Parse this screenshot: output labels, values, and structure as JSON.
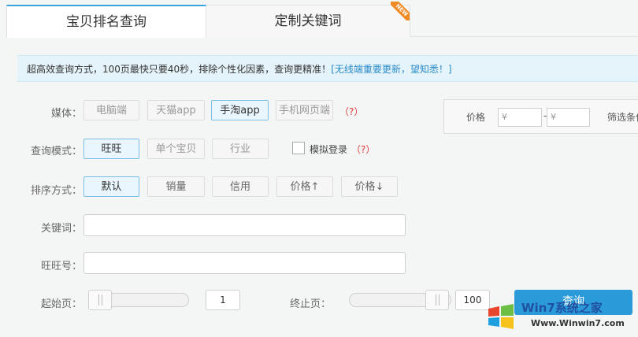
{
  "tabs": {
    "active": "宝贝排名查询",
    "inactive": "定制关键词",
    "badge": "NEW"
  },
  "notice": {
    "text": "超高效查询方式，100页最快只要40秒，排除个性化因素，查询更精准！",
    "link": "[无线端重要更新，望知悉！]"
  },
  "media": {
    "label": "媒体：",
    "options": [
      "电脑端",
      "天猫app",
      "手淘app",
      "手机网页端"
    ],
    "selected": "手淘app",
    "help": "（?）"
  },
  "query_mode": {
    "label": "查询模式：",
    "options": [
      "旺旺",
      "单个宝贝",
      "行业"
    ],
    "selected": "旺旺",
    "simulate_login": "模拟登录",
    "help": "（?）"
  },
  "sort": {
    "label": "排序方式：",
    "options": [
      "默认",
      "销量",
      "信用",
      "价格↑",
      "价格↓"
    ],
    "selected": "默认"
  },
  "keyword": {
    "label": "关键词：",
    "value": ""
  },
  "wangwang": {
    "label": "旺旺号：",
    "value": ""
  },
  "pages": {
    "start_label": "起始页：",
    "start_value": "1",
    "end_label": "终止页：",
    "end_value": "100"
  },
  "filter": {
    "price_label": "价格",
    "min_placeholder": "¥",
    "dash": "-",
    "max_placeholder": "¥",
    "filter_label": "筛选条件"
  },
  "search_label": "查询",
  "watermark": {
    "title": "Win7系统之家",
    "url": "Www.Winwin7.com"
  }
}
